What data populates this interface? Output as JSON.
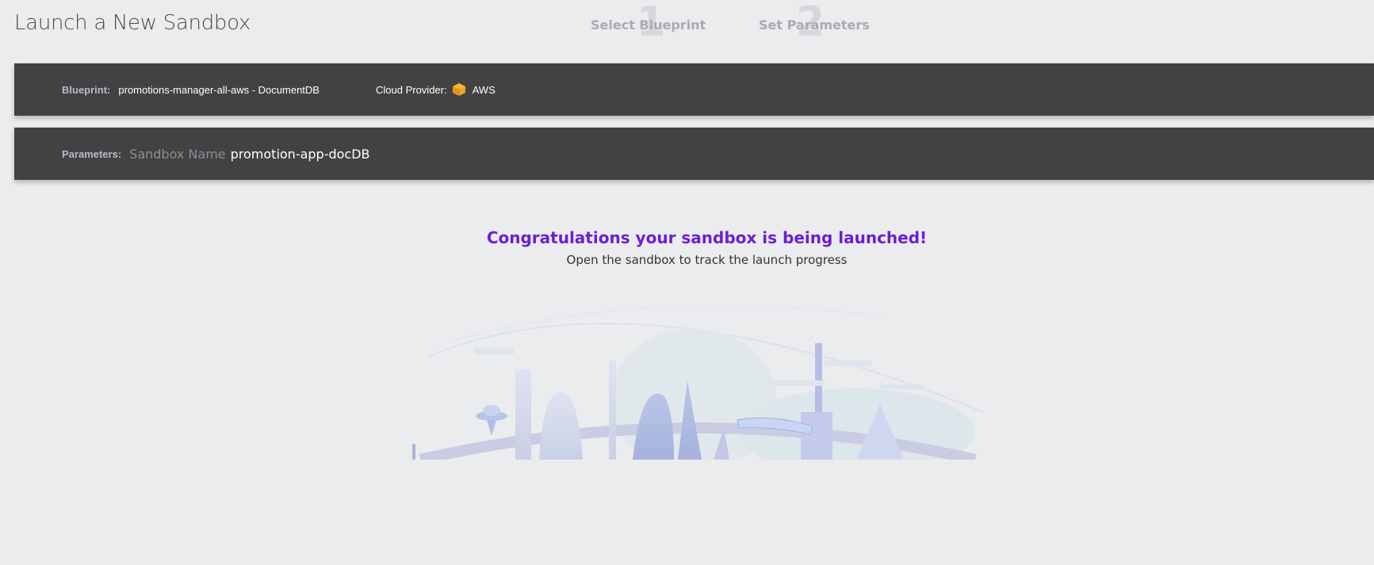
{
  "header": {
    "title": "Launch a New Sandbox",
    "steps": [
      {
        "number": "1",
        "label": "Select Blueprint"
      },
      {
        "number": "2",
        "label": "Set Parameters"
      }
    ]
  },
  "summary": {
    "blueprint_label": "Blueprint:",
    "blueprint_value": "promotions-manager-all-aws - DocumentDB",
    "cloud_provider_label": "Cloud Provider:",
    "cloud_provider_icon": "aws-cube-icon",
    "cloud_provider_value": "AWS",
    "parameters_label": "Parameters:",
    "sandbox_name_key": "Sandbox Name",
    "sandbox_name_value": "promotion-app-docDB"
  },
  "result": {
    "title": "Congratulations your sandbox is being launched!",
    "subtitle": "Open the sandbox to track the launch progress"
  },
  "colors": {
    "accent": "#6b1fd4",
    "bar": "#424244",
    "aws_orange": "#f5a623",
    "background": "#ebecee"
  }
}
